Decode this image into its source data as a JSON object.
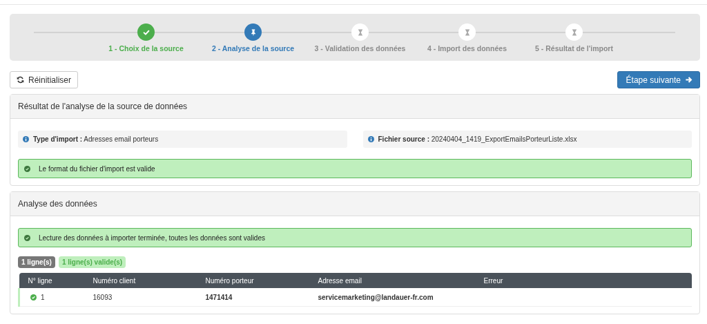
{
  "steps": [
    {
      "label": "1 - Choix de la source",
      "completed": true,
      "selected": false
    },
    {
      "label": "2 - Analyse de la source",
      "completed": false,
      "selected": true
    },
    {
      "label": "3 - Validation des données",
      "completed": false,
      "selected": false
    },
    {
      "label": "4 - Import des données",
      "completed": false,
      "selected": false
    },
    {
      "label": "5 - Résultat de l'import",
      "completed": false,
      "selected": false
    }
  ],
  "toolbar": {
    "reset_button": "Réinitialiser",
    "next_button": "Étape suivante"
  },
  "source_panel": {
    "title": "Résultat de l'analyse de la source de données",
    "info": [
      {
        "label": "Type d'import :",
        "value": "Adresses email porteurs"
      },
      {
        "label": "Fichier source :",
        "value": "20240404_1419_ExportEmailsPorteurListe.xlsx"
      }
    ],
    "alert": "Le format du fichier d'import est valide"
  },
  "data_panel": {
    "title": "Analyse des données",
    "alert": "Lecture des données à importer terminée, toutes les données sont valides",
    "badges": [
      {
        "label": "1 ligne(s)",
        "kind": "total"
      },
      {
        "label": "1 ligne(s) valide(s)",
        "kind": "valid"
      }
    ],
    "table": {
      "columns": [
        "N° ligne",
        "Numéro client",
        "Numéro porteur",
        "Adresse email",
        "Erreur"
      ],
      "rows": [
        {
          "valid": true,
          "cells": [
            "1",
            "16093",
            "1471414",
            "servicemarketing@landauer-fr.com"
          ]
        }
      ]
    }
  }
}
